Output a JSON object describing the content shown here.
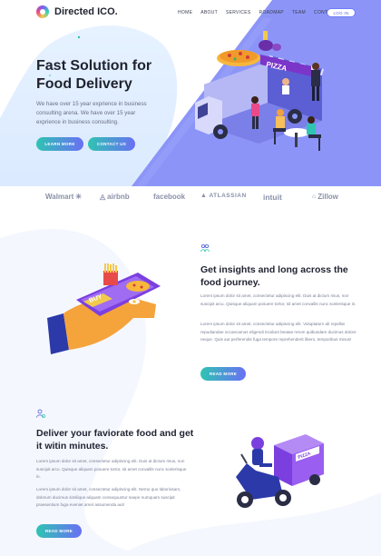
{
  "header": {
    "brand": "Directed ICO.",
    "nav": [
      "HOME",
      "ABOUT",
      "SERVICES",
      "ROADMAP",
      "TEAM",
      "CONTACT"
    ],
    "login_label": "LOG IN"
  },
  "hero": {
    "title": "Fast Solution for Food Delivery",
    "text": "We have over 15 year exprience in business consulting arena. We have over 15 year exprience in business consulting.",
    "learn_more": "LEARN MORE",
    "contact_us": "CONTACT US",
    "truck_sign": "PIZZA"
  },
  "brands": [
    "Walmart",
    "airbnb",
    "facebook",
    "ATLASSIAN",
    "intuit",
    "Zillow"
  ],
  "insights": {
    "title": "Get insights and long across the food journey.",
    "para1": "Lorem ipsum dolor sit amet, consectetur adipiscing elit. Duis at dictum risus, non suscipit arcu. Quisque aliquam posuere tortor, sit amet convallis nunc scelerisque in.",
    "para2": "Lorem ipsum dolor sit amet, consectetur adipiscing elit. Voluptatum ab repellat repudiandae occaecamus eligendi incidunt beatae rerum quibusdam ducimus dolore neque. Quis aut perferendis fuga tempore reprehenderit libero, temporibus minus!",
    "read_more": "READ MORE",
    "phone_label": "BUY"
  },
  "delivery": {
    "title": "Deliver your faviorate food and get it witin minutes.",
    "para1": "Lorem ipsum dolor sit amet, consectetur adipiscing elit. Duis at dictum risus, non suscipit arcu. Quisque aliquam posuere tortor, sit amet convallis nunc scelerisque in.",
    "para2": "Lorem ipsum dolor sit amet, consectetur adipiscing elit. Nemo quo laboriosam, dolorum ducimus similique aliquam consequuntur saepe numquam suscipit praesentium fuga eveniet amet assumenda aut!",
    "read_more": "READ MORE",
    "box_label": "PIZZA"
  },
  "colors": {
    "accent": "#7b86f7",
    "gradient_start": "#2fc4b2",
    "gradient_end": "#6a6ff5",
    "hero_light": "#e1f0ff"
  }
}
